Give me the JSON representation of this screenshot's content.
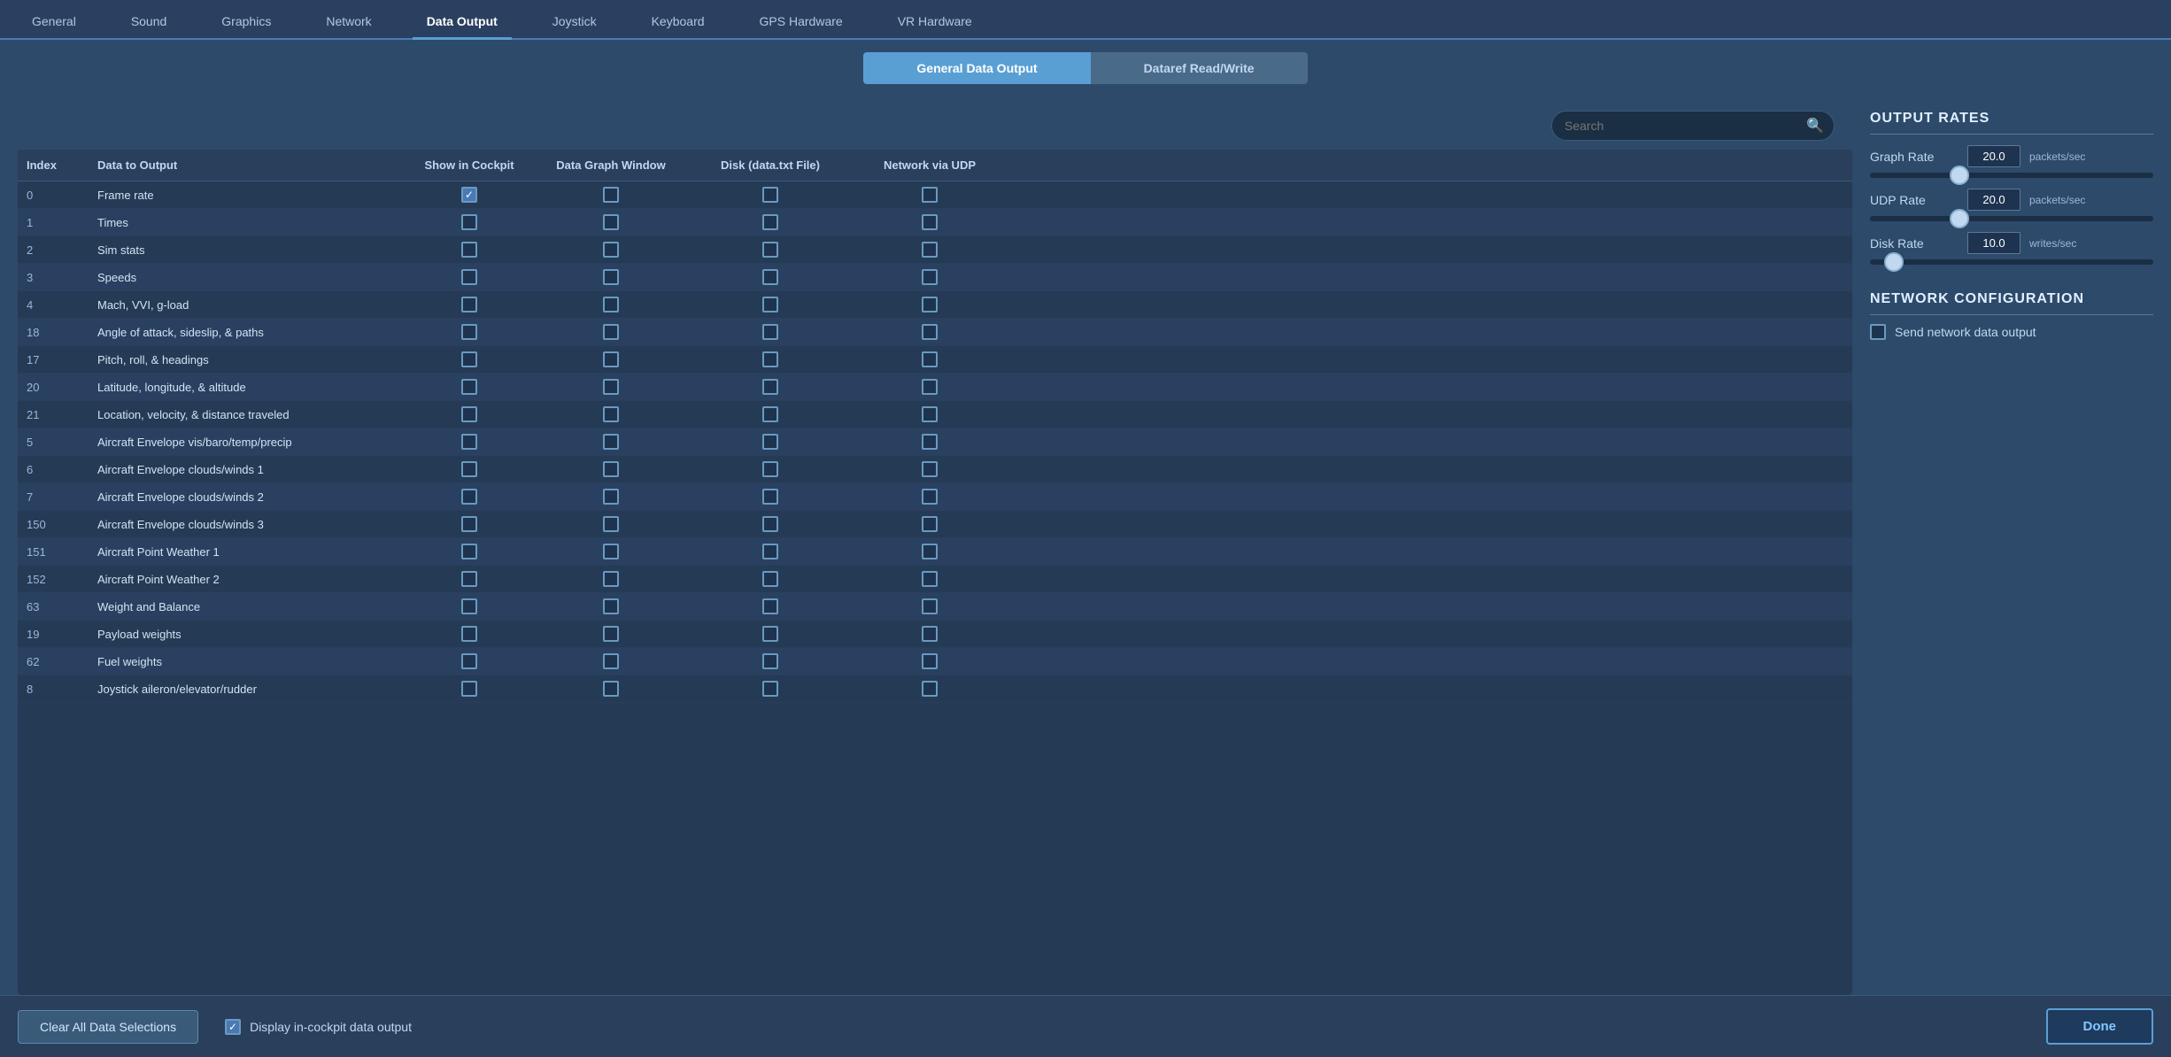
{
  "tabs": {
    "items": [
      {
        "label": "General",
        "active": false
      },
      {
        "label": "Sound",
        "active": false
      },
      {
        "label": "Graphics",
        "active": false
      },
      {
        "label": "Network",
        "active": false
      },
      {
        "label": "Data Output",
        "active": true
      },
      {
        "label": "Joystick",
        "active": false
      },
      {
        "label": "Keyboard",
        "active": false
      },
      {
        "label": "GPS Hardware",
        "active": false
      },
      {
        "label": "VR Hardware",
        "active": false
      }
    ]
  },
  "subtabs": {
    "active": "General Data Output",
    "inactive": "Dataref Read/Write"
  },
  "search": {
    "placeholder": "Search",
    "value": ""
  },
  "table": {
    "columns": [
      "Index",
      "Data to Output",
      "Show in Cockpit",
      "Data Graph Window",
      "Disk (data.txt File)",
      "Network via UDP"
    ],
    "rows": [
      {
        "index": "0",
        "label": "Frame rate",
        "cockpit": true,
        "graph": false,
        "disk": false,
        "network": false
      },
      {
        "index": "1",
        "label": "Times",
        "cockpit": false,
        "graph": false,
        "disk": false,
        "network": false
      },
      {
        "index": "2",
        "label": "Sim stats",
        "cockpit": false,
        "graph": false,
        "disk": false,
        "network": false
      },
      {
        "index": "3",
        "label": "Speeds",
        "cockpit": false,
        "graph": false,
        "disk": false,
        "network": false
      },
      {
        "index": "4",
        "label": "Mach, VVI, g-load",
        "cockpit": false,
        "graph": false,
        "disk": false,
        "network": false
      },
      {
        "index": "18",
        "label": "Angle of attack, sideslip, & paths",
        "cockpit": false,
        "graph": false,
        "disk": false,
        "network": false
      },
      {
        "index": "17",
        "label": "Pitch, roll, & headings",
        "cockpit": false,
        "graph": false,
        "disk": false,
        "network": false
      },
      {
        "index": "20",
        "label": "Latitude, longitude, & altitude",
        "cockpit": false,
        "graph": false,
        "disk": false,
        "network": false
      },
      {
        "index": "21",
        "label": "Location, velocity, & distance traveled",
        "cockpit": false,
        "graph": false,
        "disk": false,
        "network": false
      },
      {
        "index": "5",
        "label": "Aircraft Envelope vis/baro/temp/precip",
        "cockpit": false,
        "graph": false,
        "disk": false,
        "network": false
      },
      {
        "index": "6",
        "label": "Aircraft Envelope clouds/winds 1",
        "cockpit": false,
        "graph": false,
        "disk": false,
        "network": false
      },
      {
        "index": "7",
        "label": "Aircraft Envelope clouds/winds 2",
        "cockpit": false,
        "graph": false,
        "disk": false,
        "network": false
      },
      {
        "index": "150",
        "label": "Aircraft Envelope clouds/winds 3",
        "cockpit": false,
        "graph": false,
        "disk": false,
        "network": false
      },
      {
        "index": "151",
        "label": "Aircraft Point Weather 1",
        "cockpit": false,
        "graph": false,
        "disk": false,
        "network": false
      },
      {
        "index": "152",
        "label": "Aircraft Point Weather 2",
        "cockpit": false,
        "graph": false,
        "disk": false,
        "network": false
      },
      {
        "index": "63",
        "label": "Weight and Balance",
        "cockpit": false,
        "graph": false,
        "disk": false,
        "network": false
      },
      {
        "index": "19",
        "label": "Payload weights",
        "cockpit": false,
        "graph": false,
        "disk": false,
        "network": false
      },
      {
        "index": "62",
        "label": "Fuel weights",
        "cockpit": false,
        "graph": false,
        "disk": false,
        "network": false
      },
      {
        "index": "8",
        "label": "Joystick aileron/elevator/rudder",
        "cockpit": false,
        "graph": false,
        "disk": false,
        "network": false
      }
    ]
  },
  "output_rates": {
    "title": "OUTPUT RATES",
    "graph_rate": {
      "label": "Graph Rate",
      "value": "20.0",
      "unit": "packets/sec",
      "slider_pct": 30
    },
    "udp_rate": {
      "label": "UDP Rate",
      "value": "20.0",
      "unit": "packets/sec",
      "slider_pct": 30
    },
    "disk_rate": {
      "label": "Disk Rate",
      "value": "10.0",
      "unit": "writes/sec",
      "slider_pct": 10
    }
  },
  "network_config": {
    "title": "NETWORK CONFIGURATION",
    "send_label": "Send network data output",
    "checked": false
  },
  "bottom_bar": {
    "clear_button": "Clear All Data Selections",
    "display_cockpit": "Display in-cockpit data output",
    "display_cockpit_checked": true,
    "done_button": "Done"
  }
}
